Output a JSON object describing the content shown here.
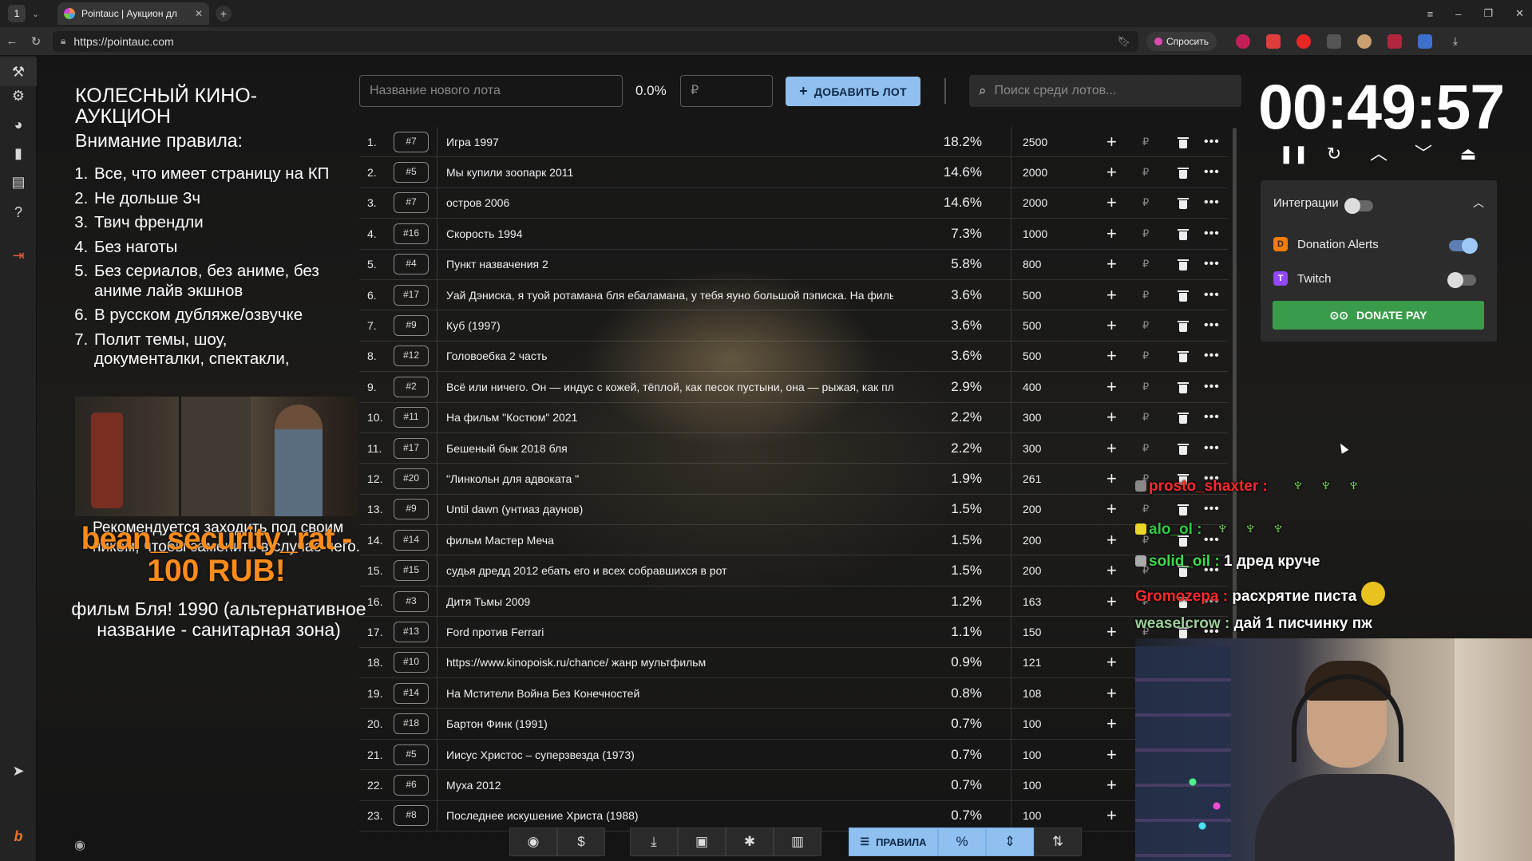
{
  "browser": {
    "workspace_number": "1",
    "tab_title": "Pointauc | Аукцион дл",
    "url": "https://pointauc.com",
    "ask_button": "Спросить"
  },
  "rules_overlay": {
    "title": "КОЛЕСНЫЙ КИНО-АУКЦИОН",
    "subtitle": "Внимание правила:",
    "items": [
      "Все, что имеет страницу на КП",
      "Не дольше 3ч",
      "Твич френдли",
      "Без наготы",
      "Без сериалов, без аниме, без аниме лайв экшнов",
      "В русском дубляже/озвучке",
      "Полит темы, шоу, документалки, спектакли,"
    ]
  },
  "donation_alert": {
    "underlying_text": "Рекомендуется заходить под своим ником, чтобы заменить в случае чего.",
    "name": "bean_security_rat -",
    "amount": "100 RUB!",
    "message": "фильм Бля! 1990 (альтернативное название - санитарная зона)"
  },
  "controls": {
    "lot_name_placeholder": "Название нового лота",
    "percent": "0.0%",
    "amount_placeholder": "₽",
    "add_lot_label": "ДОБАВИТЬ ЛОТ",
    "search_placeholder": "Поиск среди лотов..."
  },
  "lots": [
    {
      "n": "1.",
      "id": "#7",
      "name": "Игра 1997",
      "pct": "18.2%",
      "amount": "2500"
    },
    {
      "n": "2.",
      "id": "#5",
      "name": "Мы купили зоопарк 2011",
      "pct": "14.6%",
      "amount": "2000"
    },
    {
      "n": "3.",
      "id": "#7",
      "name": "остров 2006",
      "pct": "14.6%",
      "amount": "2000"
    },
    {
      "n": "4.",
      "id": "#16",
      "name": "Скорость 1994",
      "pct": "7.3%",
      "amount": "1000"
    },
    {
      "n": "5.",
      "id": "#4",
      "name": "Пункт назвачения 2",
      "pct": "5.8%",
      "amount": "800"
    },
    {
      "n": "6.",
      "id": "#17",
      "name": "Уай Дэниска, я туой ротамана бля ебаламана, у тебя яуно большой пэписка. На фильм бой",
      "pct": "3.6%",
      "amount": "500"
    },
    {
      "n": "7.",
      "id": "#9",
      "name": "Куб (1997)",
      "pct": "3.6%",
      "amount": "500"
    },
    {
      "n": "8.",
      "id": "#12",
      "name": "Головоебка 2 часть",
      "pct": "3.6%",
      "amount": "500"
    },
    {
      "n": "9.",
      "id": "#2",
      "name": "Всё или ничего. Он — индус с кожей, тёплой, как песок пустыни, она — рыжая, как пламя. И",
      "pct": "2.9%",
      "amount": "400"
    },
    {
      "n": "10.",
      "id": "#11",
      "name": "На фильм \"Костюм\" 2021",
      "pct": "2.2%",
      "amount": "300"
    },
    {
      "n": "11.",
      "id": "#17",
      "name": "Бешеный бык 2018 бля",
      "pct": "2.2%",
      "amount": "300"
    },
    {
      "n": "12.",
      "id": "#20",
      "name": "\"Линкольн для адвоката \"",
      "pct": "1.9%",
      "amount": "261"
    },
    {
      "n": "13.",
      "id": "#9",
      "name": "Until dawn (унтиаз даунов)",
      "pct": "1.5%",
      "amount": "200"
    },
    {
      "n": "14.",
      "id": "#14",
      "name": "фильм Мастер Меча",
      "pct": "1.5%",
      "amount": "200"
    },
    {
      "n": "15.",
      "id": "#15",
      "name": "судья дредд 2012 ебать его и всех собравшихся в рот",
      "pct": "1.5%",
      "amount": "200"
    },
    {
      "n": "16.",
      "id": "#3",
      "name": "Дитя Тьмы 2009",
      "pct": "1.2%",
      "amount": "163"
    },
    {
      "n": "17.",
      "id": "#13",
      "name": "Ford против Ferrari",
      "pct": "1.1%",
      "amount": "150"
    },
    {
      "n": "18.",
      "id": "#10",
      "name": "https://www.kinopoisk.ru/chance/ жанр мультфильм",
      "pct": "0.9%",
      "amount": "121"
    },
    {
      "n": "19.",
      "id": "#14",
      "name": "На Мстители Война Без Конечностей",
      "pct": "0.8%",
      "amount": "108"
    },
    {
      "n": "20.",
      "id": "#18",
      "name": "Бартон Финк (1991)",
      "pct": "0.7%",
      "amount": "100"
    },
    {
      "n": "21.",
      "id": "#5",
      "name": "Иисус Христос – суперзвезда (1973)",
      "pct": "0.7%",
      "amount": "100"
    },
    {
      "n": "22.",
      "id": "#6",
      "name": "Муха 2012",
      "pct": "0.7%",
      "amount": "100"
    },
    {
      "n": "23.",
      "id": "#8",
      "name": "Последнее искушение Христа (1988)",
      "pct": "0.7%",
      "amount": "100"
    }
  ],
  "row_actions": {
    "rub": "₽",
    "more": "•••"
  },
  "bottom_toolbar": {
    "rules_label": "ПРАВИЛА",
    "percent_label": "%",
    "dollar_label": "$"
  },
  "timer": {
    "value": "00:49:57"
  },
  "integrations": {
    "title": "Интеграции",
    "enabled": false,
    "items": [
      {
        "name": "Donation Alerts",
        "enabled": true
      },
      {
        "name": "Twitch",
        "enabled": false
      }
    ],
    "donate_pay_label": "DONATE PAY"
  },
  "chat": [
    {
      "user": "prosto_shaxter :",
      "message": "",
      "color": "#ff2a2a"
    },
    {
      "user": "alo_ol :",
      "message": "",
      "color": "#2ecc40"
    },
    {
      "user": "solid_oil :",
      "message": "1 дред круче",
      "color": "#3ddc4a"
    },
    {
      "user": "Gromozepa :",
      "message": "расхрятие писта",
      "color": "#ff2a2a"
    },
    {
      "user": "weaselcrow :",
      "message": "дай 1 писчинку пж",
      "color": "#9ccf9a"
    }
  ],
  "colors": {
    "accent_blue": "#8fc0f0",
    "donate_green": "#3a9b4a",
    "donation_orange": "#ff8c1a",
    "logout_red": "#e55a3c"
  }
}
